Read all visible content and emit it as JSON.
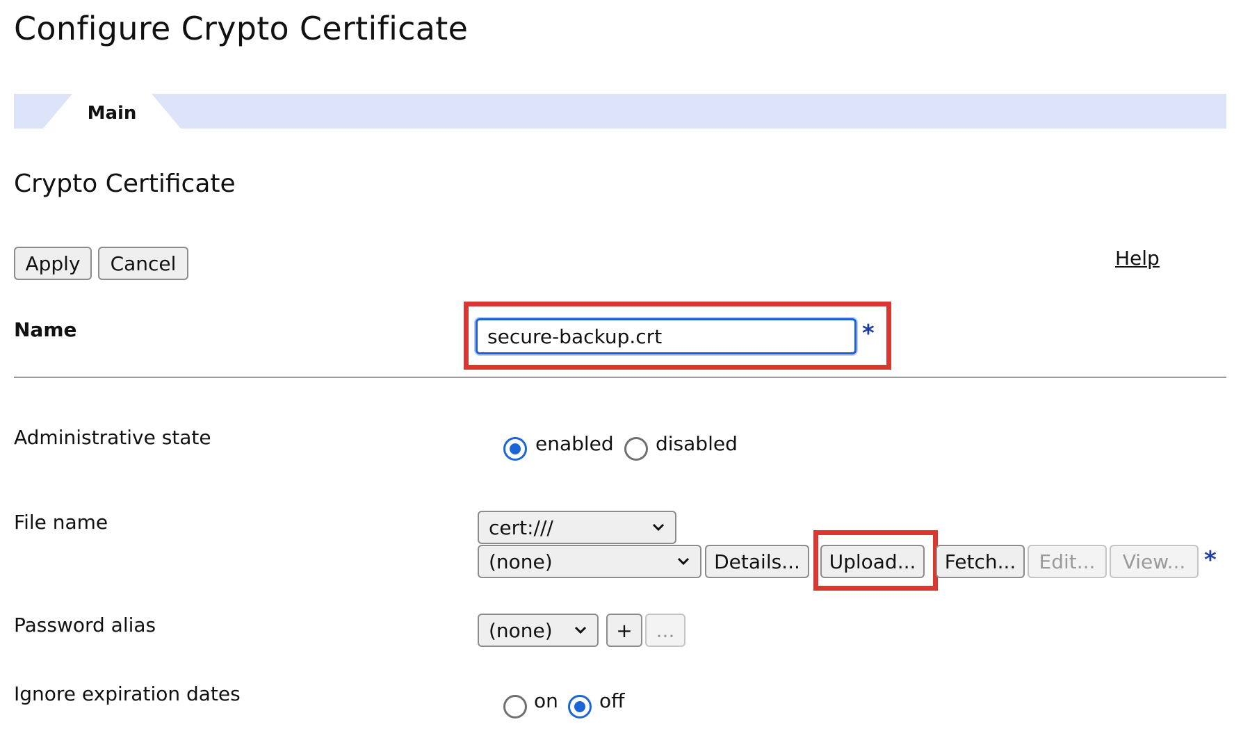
{
  "page": {
    "title": "Configure Crypto Certificate"
  },
  "tabs": [
    {
      "label": "Main"
    }
  ],
  "section": {
    "title": "Crypto Certificate"
  },
  "actions": {
    "apply_label": "Apply",
    "cancel_label": "Cancel",
    "help_label": "Help"
  },
  "name_field": {
    "label": "Name",
    "value": "secure-backup.crt",
    "required_marker": "*"
  },
  "admin_state": {
    "label": "Administrative state",
    "options": [
      {
        "label": "enabled",
        "checked": true
      },
      {
        "label": "disabled",
        "checked": false
      }
    ]
  },
  "file_name": {
    "label": "File name",
    "directory_value": "cert:///",
    "file_value": "(none)",
    "buttons": {
      "details": "Details...",
      "upload": "Upload...",
      "fetch": "Fetch...",
      "edit": "Edit...",
      "view": "View..."
    },
    "required_marker": "*"
  },
  "password_alias": {
    "label": "Password alias",
    "value": "(none)",
    "add_label": "+",
    "more_label": "..."
  },
  "ignore_expiration": {
    "label": "Ignore expiration dates",
    "options": [
      {
        "label": "on",
        "checked": false
      },
      {
        "label": "off",
        "checked": true
      }
    ]
  },
  "colors": {
    "tab_bar": "#dde3f8",
    "highlight_box": "#d93732",
    "focus_blue": "#1c5dd8",
    "required_star": "#1f3fa6"
  }
}
